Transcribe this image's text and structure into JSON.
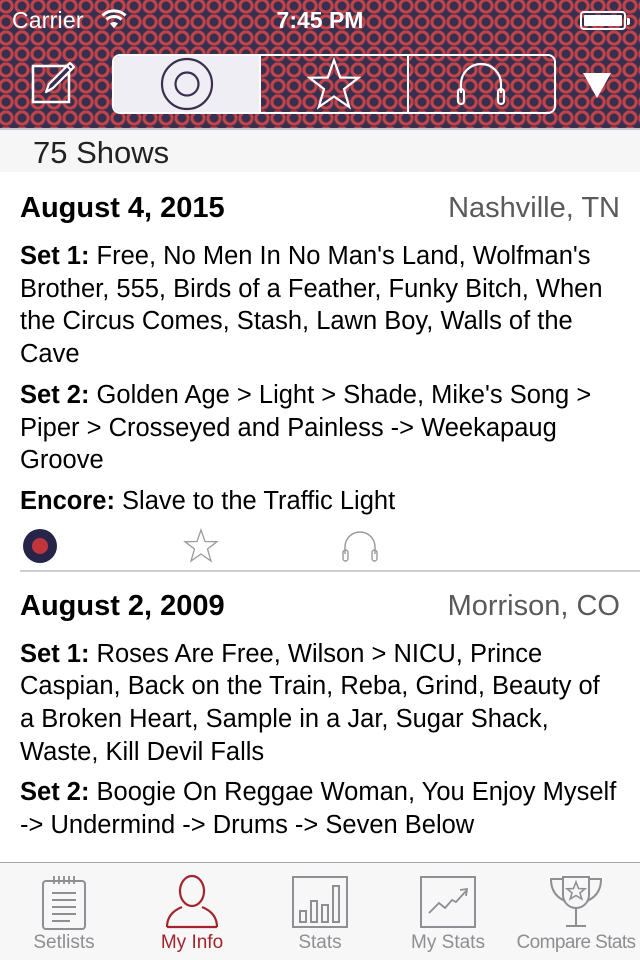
{
  "status_bar": {
    "carrier": "Carrier",
    "time": "7:45 PM",
    "wifi_icon": "wifi-icon",
    "battery_icon": "battery-full-icon"
  },
  "toolbar": {
    "compose_icon": "compose-icon",
    "segments": [
      {
        "icon": "record-icon",
        "label": "Attended",
        "active": true
      },
      {
        "icon": "star-icon",
        "label": "Favorites",
        "active": false
      },
      {
        "icon": "headphones-icon",
        "label": "Listened",
        "active": false
      }
    ],
    "dropdown_icon": "triangle-down-icon"
  },
  "section": {
    "title": "75 Shows"
  },
  "shows": [
    {
      "date": "August 4, 2015",
      "location": "Nashville, TN",
      "sets": [
        {
          "label": "Set 1:",
          "songs": "Free, No Men In No Man's Land, Wolfman's Brother, 555, Birds of a Feather, Funky Bitch, When the Circus Comes, Stash, Lawn Boy, Walls of the Cave"
        },
        {
          "label": "Set 2:",
          "songs": "Golden Age > Light > Shade, Mike's Song > Piper > Crosseyed and Painless -> Weekapaug Groove"
        },
        {
          "label": "Encore:",
          "songs": "Slave to the Traffic Light"
        }
      ],
      "attended": true,
      "favorited": false,
      "listened": false
    },
    {
      "date": "August 2, 2009",
      "location": "Morrison, CO",
      "sets": [
        {
          "label": "Set 1:",
          "songs": "Roses Are Free, Wilson > NICU, Prince Caspian, Back on the Train, Reba, Grind, Beauty of a Broken Heart, Sample in a Jar, Sugar Shack, Waste, Kill Devil Falls"
        },
        {
          "label": "Set 2:",
          "songs": "Boogie On Reggae Woman, You Enjoy Myself -> Undermind -> Drums -> Seven Below"
        }
      ]
    }
  ],
  "tabbar": {
    "tabs": [
      {
        "label": "Setlists",
        "icon": "notepad-icon",
        "active": false
      },
      {
        "label": "My Info",
        "icon": "person-icon",
        "active": true
      },
      {
        "label": "Stats",
        "icon": "bar-chart-icon",
        "active": false
      },
      {
        "label": "My Stats",
        "icon": "trend-chart-icon",
        "active": false
      },
      {
        "label": "Compare Stats",
        "icon": "trophy-icon",
        "active": false
      }
    ]
  },
  "colors": {
    "header_bg": "#38304f",
    "header_pattern": "#c2434a",
    "accent": "#a3242e",
    "record_outer": "#27244a",
    "record_inner": "#c2343c",
    "tab_inactive": "#8e8e93"
  }
}
